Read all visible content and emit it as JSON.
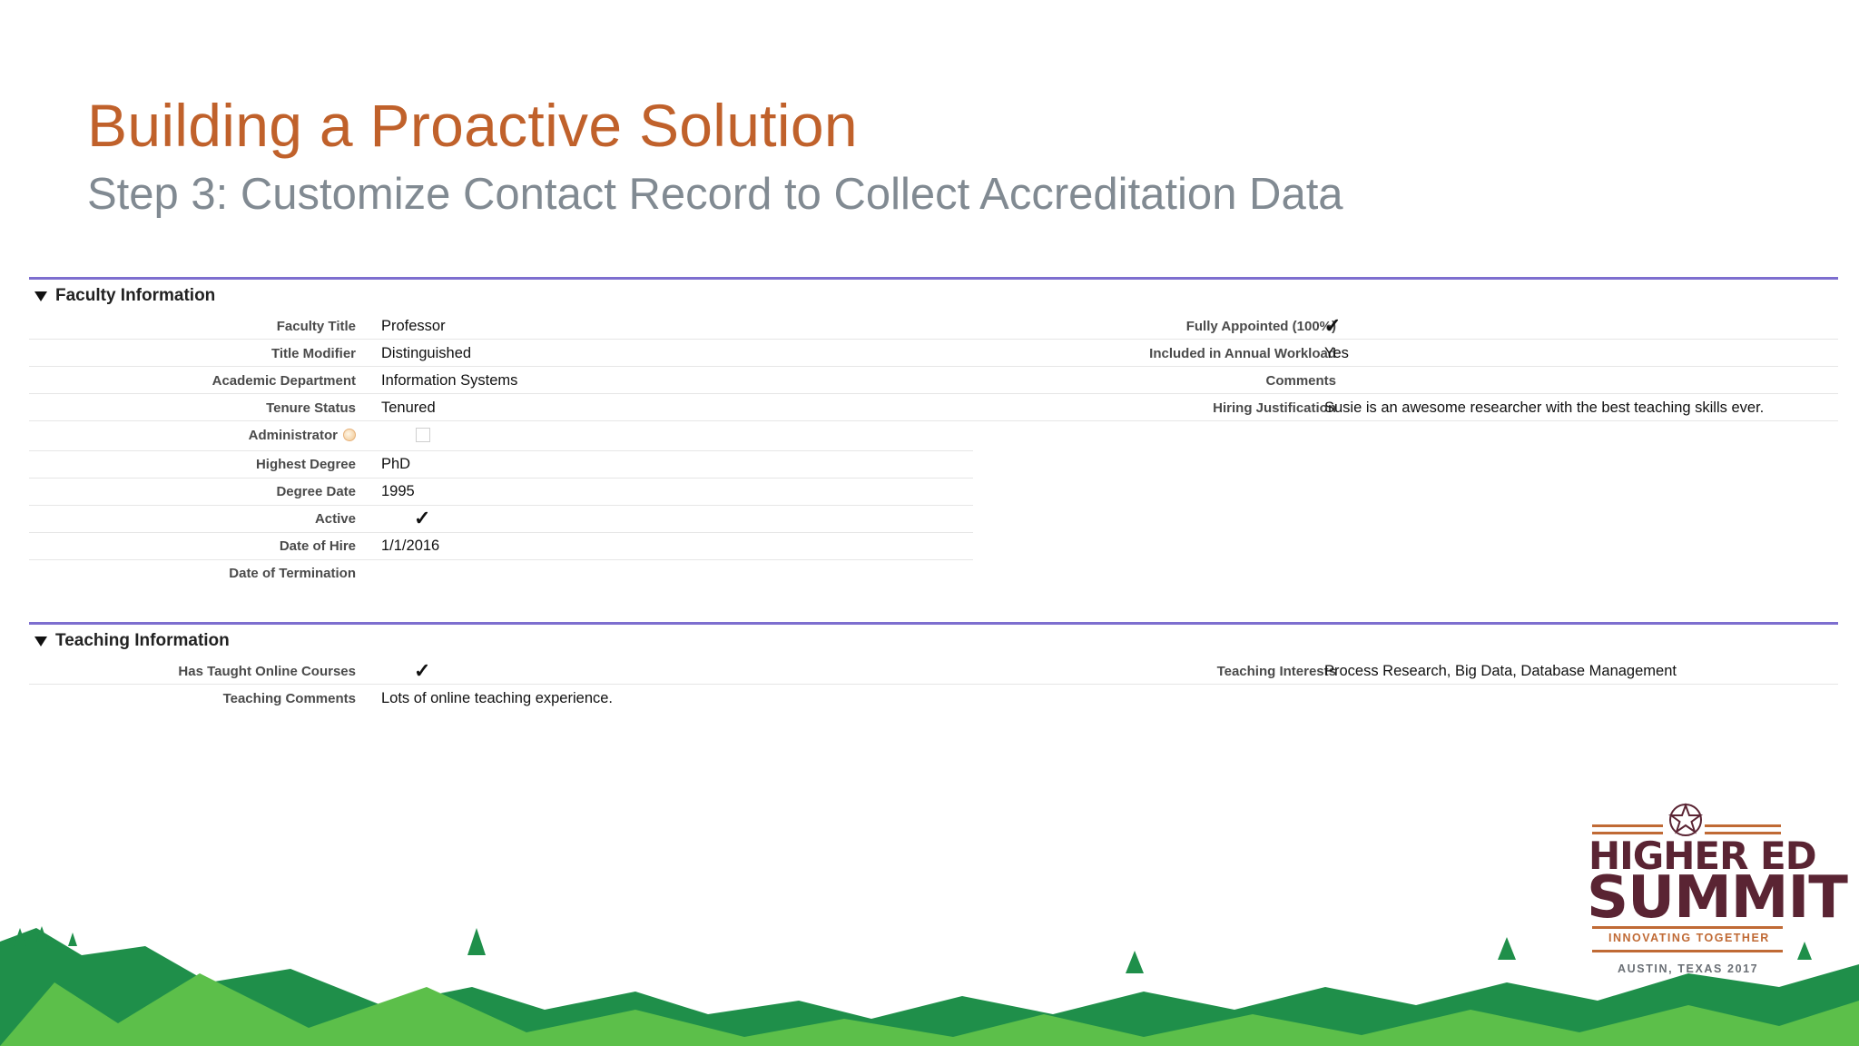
{
  "slide": {
    "title": "Building a Proactive Solution",
    "subtitle": "Step 3:  Customize Contact Record to Collect Accreditation Data"
  },
  "faculty_section": {
    "header": "Faculty Information",
    "left_fields": [
      {
        "label": "Faculty Title",
        "value": "Professor"
      },
      {
        "label": "Title Modifier",
        "value": "Distinguished"
      },
      {
        "label": "Academic Department",
        "value": "Information Systems"
      },
      {
        "label": "Tenure Status",
        "value": "Tenured"
      },
      {
        "label": "Administrator",
        "value": ""
      },
      {
        "label": "Highest Degree",
        "value": "PhD"
      },
      {
        "label": "Degree Date",
        "value": "1995"
      },
      {
        "label": "Active",
        "value": ""
      },
      {
        "label": "Date of Hire",
        "value": "1/1/2016"
      },
      {
        "label": "Date of Termination",
        "value": ""
      }
    ],
    "right_fields": [
      {
        "label": "Fully Appointed (100%)",
        "value": ""
      },
      {
        "label": "Included in Annual Workload",
        "value": "Yes"
      },
      {
        "label": "Comments",
        "value": ""
      },
      {
        "label": "Hiring Justification",
        "value": "Susie is an awesome researcher with the best teaching skills ever."
      }
    ],
    "checkbox_states": {
      "fully_appointed": true,
      "administrator": false,
      "active": true
    }
  },
  "teaching_section": {
    "header": "Teaching Information",
    "left_fields": [
      {
        "label": "Has Taught Online Courses",
        "value": ""
      },
      {
        "label": "Teaching Comments",
        "value": "Lots of online teaching experience."
      }
    ],
    "right_fields": [
      {
        "label": "Teaching Interests",
        "value": "Process Research, Big Data, Database Management"
      }
    ],
    "checkbox_states": {
      "has_taught_online": true
    }
  },
  "icons": {
    "check": "✓",
    "collapse": "triangle-down-icon",
    "help": "help-icon",
    "star": "star-icon"
  },
  "logo": {
    "line1": "HIGHER ED",
    "line2": "SUMMIT",
    "tagline": "INNOVATING TOGETHER",
    "location": "AUSTIN, TEXAS 2017"
  },
  "colors": {
    "title": "#c0612b",
    "subtitle": "#818a92",
    "section_rule": "#7d6ecf",
    "logo_primary": "#5a2433",
    "logo_accent": "#c06a35",
    "tree_dark": "#1f8f4a",
    "tree_light": "#5cbf4a"
  }
}
